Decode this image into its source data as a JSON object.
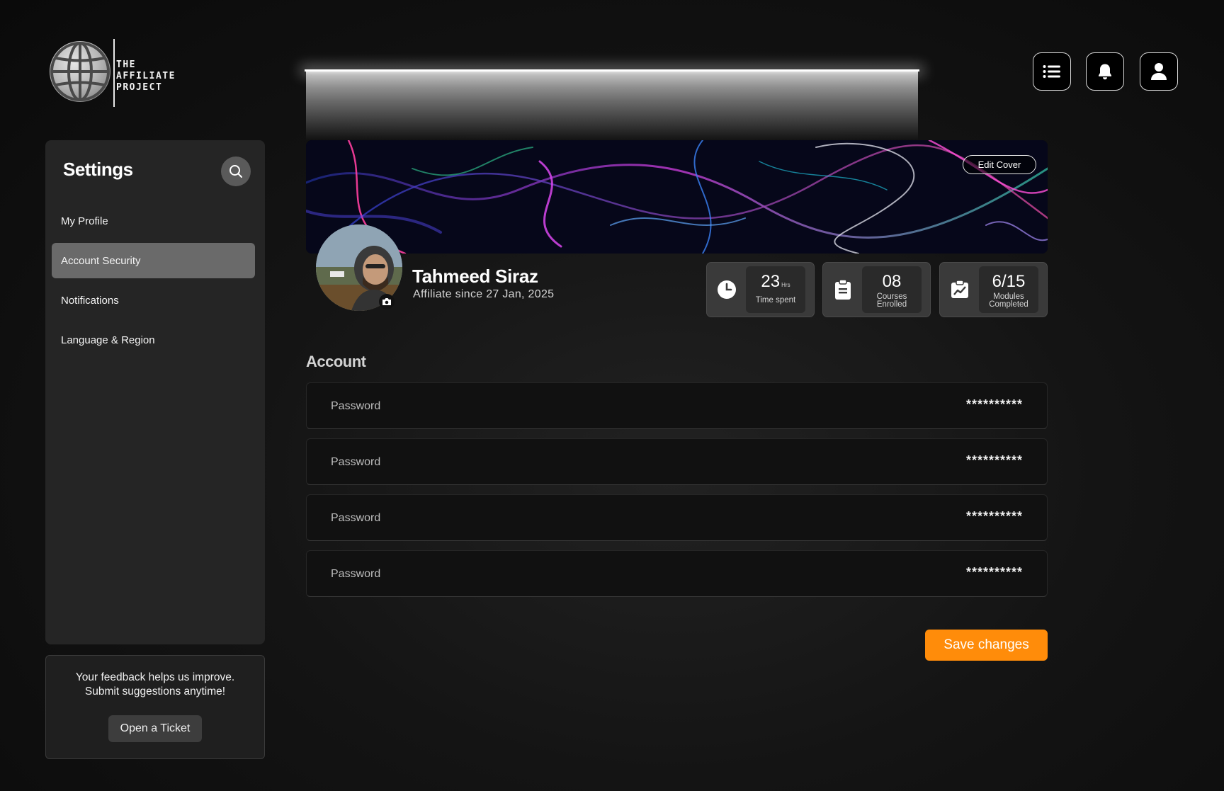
{
  "brand": {
    "logo_lines": [
      "THE",
      "AFFILIATE",
      "PROJECT"
    ]
  },
  "header": {
    "buttons": [
      {
        "icon": "menu-list-icon"
      },
      {
        "icon": "bell-icon"
      },
      {
        "icon": "user-icon"
      }
    ]
  },
  "sidebar": {
    "title": "Settings",
    "search_icon": "search-icon",
    "items": [
      {
        "label": "My Profile",
        "active": false
      },
      {
        "label": "Account Security",
        "active": true
      },
      {
        "label": "Notifications",
        "active": false
      },
      {
        "label": "Language & Region",
        "active": false
      }
    ]
  },
  "feedback": {
    "line1": "Your feedback helps us improve.",
    "line2": "Submit suggestions anytime!",
    "button_label": "Open a Ticket"
  },
  "profile": {
    "edit_cover_label": "Edit Cover",
    "name": "Tahmeed Siraz",
    "since": "Affiliate since 27 Jan, 2025",
    "stats": [
      {
        "icon": "clock-icon",
        "value": "23",
        "unit": "Hrs",
        "label": "Time spent"
      },
      {
        "icon": "clipboard-icon",
        "value": "08",
        "unit": "",
        "label": "Courses Enrolled"
      },
      {
        "icon": "chart-icon",
        "value": "6/15",
        "unit": "",
        "label": "Modules Completed"
      }
    ]
  },
  "account": {
    "title": "Account",
    "fields": [
      {
        "label": "Password",
        "value": "**********"
      },
      {
        "label": "Password",
        "value": "**********"
      },
      {
        "label": "Password",
        "value": "**********"
      },
      {
        "label": "Password",
        "value": "**********"
      }
    ]
  },
  "actions": {
    "save_label": "Save changes"
  },
  "colors": {
    "accent": "#ff8c0a",
    "background": "#141414",
    "panel": "#252525",
    "active_item": "#6a6a6a"
  }
}
